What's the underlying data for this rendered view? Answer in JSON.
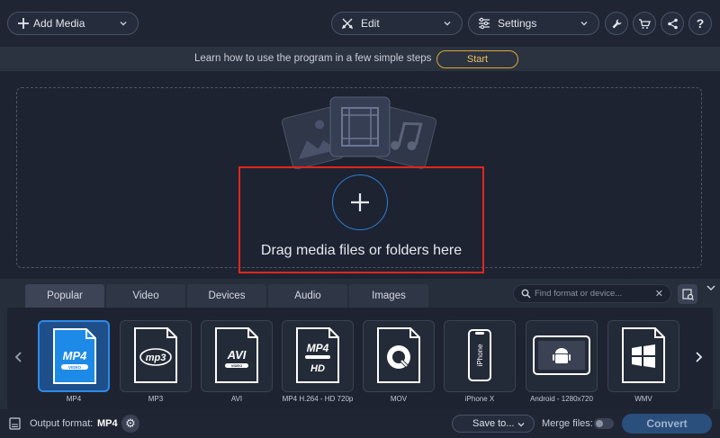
{
  "toolbar": {
    "add_media_label": "Add Media",
    "edit_label": "Edit",
    "settings_label": "Settings",
    "icons": [
      "plus-icon",
      "scissors-icon",
      "sliders-icon",
      "wrench-icon",
      "cart-icon",
      "share-icon",
      "help-icon"
    ]
  },
  "banner": {
    "text": "Learn how to use the program in a few simple steps",
    "start_label": "Start"
  },
  "dropzone": {
    "text": "Drag media files or folders here"
  },
  "formats": {
    "tabs": [
      {
        "label": "Popular",
        "active": true
      },
      {
        "label": "Video",
        "active": false
      },
      {
        "label": "Devices",
        "active": false
      },
      {
        "label": "Audio",
        "active": false
      },
      {
        "label": "Images",
        "active": false
      }
    ],
    "search_placeholder": "Find format or device...",
    "tiles": [
      {
        "label": "MP4",
        "badge": "MP4",
        "sub": "VIDEO",
        "active": true
      },
      {
        "label": "MP3",
        "badge": "mp3",
        "sub": "",
        "active": false
      },
      {
        "label": "AVI",
        "badge": "AVI",
        "sub": "VIDEO",
        "active": false
      },
      {
        "label": "MP4 H.264 - HD 720p",
        "badge": "MP4",
        "sub": "HD",
        "active": false
      },
      {
        "label": "MOV",
        "badge": "Q",
        "sub": "",
        "active": false
      },
      {
        "label": "iPhone X",
        "badge": "iPhone",
        "sub": "",
        "active": false
      },
      {
        "label": "Android - 1280x720",
        "badge": "",
        "sub": "",
        "active": false
      },
      {
        "label": "WMV",
        "badge": "",
        "sub": "",
        "active": false
      }
    ]
  },
  "bottom": {
    "output_label": "Output format:",
    "output_value": "MP4",
    "save_label": "Save to...",
    "merge_label": "Merge files:",
    "convert_label": "Convert"
  },
  "colors": {
    "accent_blue": "#2e8ae6",
    "start_border": "#e0a632",
    "highlight_red": "#e1261c"
  }
}
